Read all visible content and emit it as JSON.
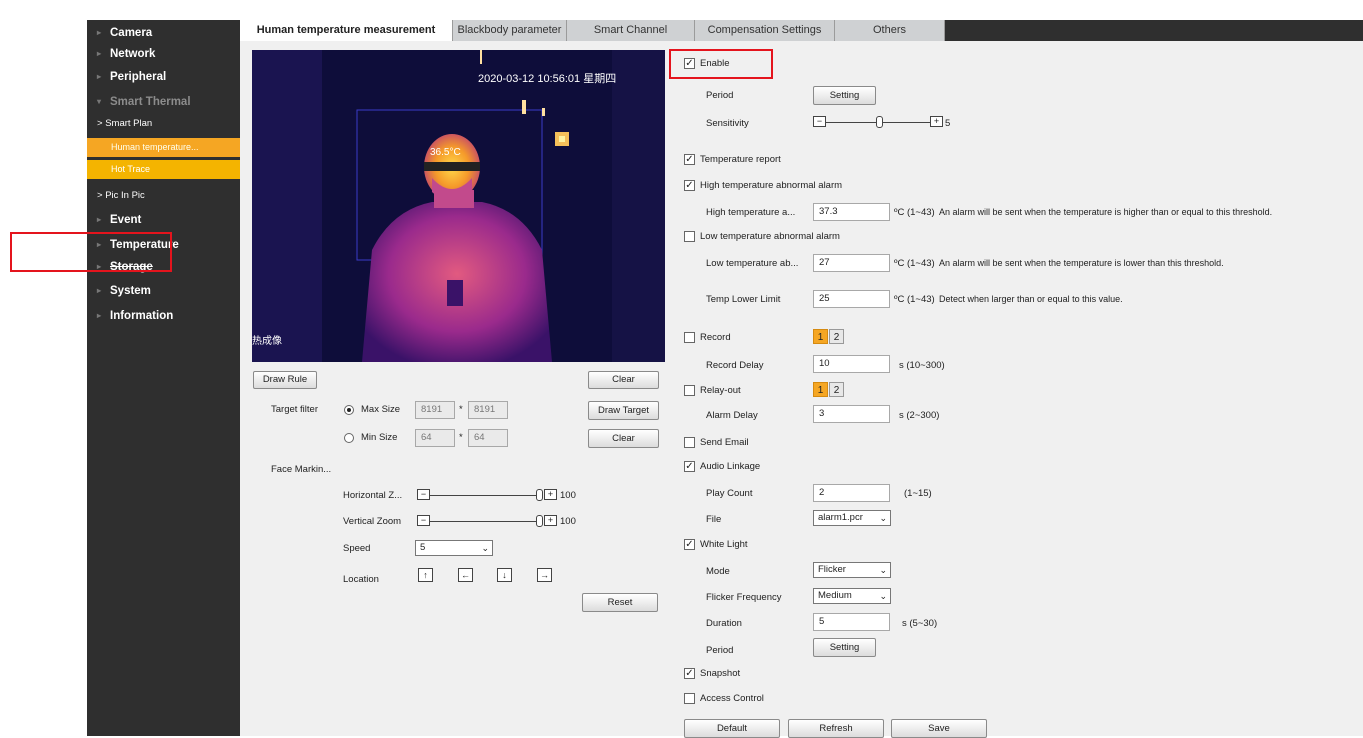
{
  "sidebar": {
    "items": [
      {
        "label": "Camera"
      },
      {
        "label": "Network"
      },
      {
        "label": "Peripheral"
      },
      {
        "label": "Smart Thermal"
      },
      {
        "label": "Smart Plan"
      },
      {
        "label": "Human temperature..."
      },
      {
        "label": "Hot Trace"
      },
      {
        "label": "Pic In Pic"
      },
      {
        "label": "Event"
      },
      {
        "label": "Temperature"
      },
      {
        "label": "Storage"
      },
      {
        "label": "System"
      },
      {
        "label": "Information"
      }
    ]
  },
  "tabs": [
    {
      "label": "Human temperature measurement"
    },
    {
      "label": "Blackbody parameter"
    },
    {
      "label": "Smart Channel"
    },
    {
      "label": "Compensation Settings"
    },
    {
      "label": "Others"
    }
  ],
  "video": {
    "timestamp": "2020-03-12 10:56:01 星期四",
    "temp_label": "36.5°C",
    "channel_label": "热成像"
  },
  "left": {
    "draw_rule": "Draw Rule",
    "clear1": "Clear",
    "draw_target": "Draw Target",
    "clear2": "Clear",
    "target_filter": "Target filter",
    "max_size": "Max Size",
    "max_w": "8191",
    "max_h": "8191",
    "min_size": "Min Size",
    "min_w": "64",
    "min_h": "64",
    "times": "*",
    "face_marking": "Face Markin...",
    "horizontal_zoom": "Horizontal Z...",
    "horizontal_value": "100",
    "vertical_zoom": "Vertical Zoom",
    "vertical_value": "100",
    "speed": "Speed",
    "speed_value": "5",
    "location": "Location",
    "reset": "Reset"
  },
  "right": {
    "enable": "Enable",
    "period": "Period",
    "setting": "Setting",
    "sensitivity": "Sensitivity",
    "sensitivity_value": "5",
    "temperature_report": "Temperature report",
    "high_alarm": "High temperature abnormal alarm",
    "high_label": "High temperature a...",
    "high_value": "37.3",
    "high_unit": "ºC (1~43)",
    "high_desc": "An alarm will be sent when the temperature is higher than or equal to this threshold.",
    "low_alarm": "Low temperature abnormal alarm",
    "low_label": "Low temperature ab...",
    "low_value": "27",
    "low_unit": "ºC (1~43)",
    "low_desc": "An alarm will be sent when the temperature is lower than this threshold.",
    "temp_lower_limit": "Temp Lower Limit",
    "lower_value": "25",
    "lower_unit": "ºC (1~43)",
    "lower_desc": "Detect when larger than or equal to this value.",
    "record": "Record",
    "ch1": "1",
    "ch2": "2",
    "record_delay": "Record Delay",
    "record_delay_value": "10",
    "record_delay_unit": "s (10~300)",
    "relay_out": "Relay-out",
    "alarm_delay": "Alarm Delay",
    "alarm_delay_value": "3",
    "alarm_delay_unit": "s (2~300)",
    "send_email": "Send Email",
    "audio_linkage": "Audio Linkage",
    "play_count": "Play Count",
    "play_count_value": "2",
    "play_count_unit": "(1~15)",
    "file": "File",
    "file_value": "alarm1.pcr",
    "white_light": "White Light",
    "mode": "Mode",
    "mode_value": "Flicker",
    "flicker_frequency": "Flicker Frequency",
    "flicker_value": "Medium",
    "duration": "Duration",
    "duration_value": "5",
    "duration_unit": "s (5~30)",
    "period2": "Period",
    "setting2": "Setting",
    "snapshot": "Snapshot",
    "access_control": "Access Control",
    "default": "Default",
    "refresh": "Refresh",
    "save": "Save"
  },
  "checks": {
    "enable": "✓",
    "temperature_report": "✓",
    "high_alarm": "✓",
    "audio_linkage": "✓",
    "white_light": "✓",
    "snapshot": "✓"
  },
  "icons": {
    "minus": "−",
    "plus": "+",
    "up": "↑",
    "left": "←",
    "down": "↓",
    "right": "→",
    "chevron": "⌄",
    "arrow": "▸"
  },
  "colors": {
    "sidebar_bg": "#2f2f2f",
    "active_item": "#f5a623",
    "highlight": "#e4141d"
  }
}
